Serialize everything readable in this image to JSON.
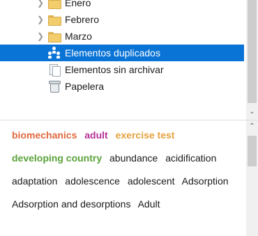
{
  "tree": {
    "items": [
      {
        "label": "Enero",
        "icon": "folder-icon",
        "expandable": true
      },
      {
        "label": "Febrero",
        "icon": "folder-icon",
        "expandable": true
      },
      {
        "label": "Marzo",
        "icon": "folder-icon",
        "expandable": true
      },
      {
        "label": "Elementos duplicados",
        "icon": "duplicates-icon",
        "selected": true
      },
      {
        "label": "Elementos sin archivar",
        "icon": "unfiled-items-icon"
      },
      {
        "label": "Papelera",
        "icon": "trash-icon"
      }
    ],
    "selection_color": "#0a74d6"
  },
  "tags": [
    {
      "label": "biomechanics",
      "color": "#e0693e",
      "bold": true
    },
    {
      "label": "adult",
      "color": "#b52f96",
      "bold": true
    },
    {
      "label": "exercise test",
      "color": "#e5a13c",
      "bold": true
    },
    {
      "label": "developing country",
      "color": "#5aa23a",
      "bold": true
    },
    {
      "label": "abundance",
      "color": "#1a1a1a",
      "bold": false
    },
    {
      "label": "acidification",
      "color": "#1a1a1a",
      "bold": false
    },
    {
      "label": "adaptation",
      "color": "#1a1a1a",
      "bold": false
    },
    {
      "label": "adolescence",
      "color": "#1a1a1a",
      "bold": false
    },
    {
      "label": "adolescent",
      "color": "#1a1a1a",
      "bold": false
    },
    {
      "label": "Adsorption",
      "color": "#1a1a1a",
      "bold": false
    },
    {
      "label": "Adsorption and desorptions",
      "color": "#1a1a1a",
      "bold": false
    },
    {
      "label": "Adult",
      "color": "#1a1a1a",
      "bold": false
    }
  ],
  "scrollbars": {
    "tree_arrow_down": "⌄",
    "tags_arrow_up": "⌃"
  }
}
